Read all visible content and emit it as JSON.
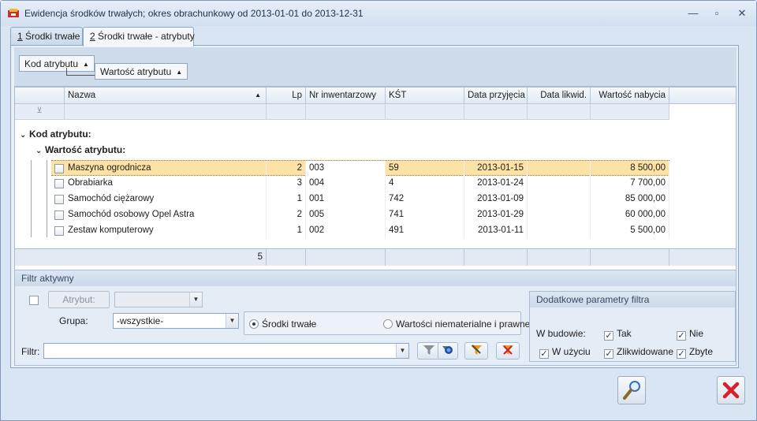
{
  "window": {
    "title": "Ewidencja środków trwałych; okres obrachunkowy od 2013-01-01 do 2013-12-31",
    "minimize": "—",
    "maximize": "▫",
    "close": "✕"
  },
  "tabs": [
    {
      "num": "1",
      "label": " Środki trwałe"
    },
    {
      "num": "2",
      "label": " Środki trwałe - atrybuty"
    }
  ],
  "grouping": {
    "chip1": "Kod atrybutu",
    "chip2": "Wartość atrybutu"
  },
  "grid": {
    "columns": [
      "Nazwa",
      "Lp",
      "Nr inwentarzowy",
      "KŚT",
      "Data przyjęcia",
      "Data likwid.",
      "Wartość nabycia"
    ],
    "group1_label": "Kod atrybutu:",
    "group2_label": "Wartość atrybutu:",
    "rows": [
      {
        "nazwa": "Maszyna ogrodnicza",
        "lp": "2",
        "nr": "003",
        "kst": "59",
        "data_przyjecia": "2013-01-15",
        "data_likwid": "",
        "wartosc": "8 500,00"
      },
      {
        "nazwa": "Obrabiarka",
        "lp": "3",
        "nr": "004",
        "kst": "4",
        "data_przyjecia": "2013-01-24",
        "data_likwid": "",
        "wartosc": "7 700,00"
      },
      {
        "nazwa": "Samochód ciężarowy",
        "lp": "1",
        "nr": "001",
        "kst": "742",
        "data_przyjecia": "2013-01-09",
        "data_likwid": "",
        "wartosc": "85 000,00"
      },
      {
        "nazwa": "Samochód osobowy Opel Astra",
        "lp": "2",
        "nr": "005",
        "kst": "741",
        "data_przyjecia": "2013-01-29",
        "data_likwid": "",
        "wartosc": "60 000,00"
      },
      {
        "nazwa": "Zestaw komputerowy",
        "lp": "1",
        "nr": "002",
        "kst": "491",
        "data_przyjecia": "2013-01-11",
        "data_likwid": "",
        "wartosc": "5 500,00"
      }
    ],
    "footer_count": "5"
  },
  "filter": {
    "title": "Filtr aktywny",
    "atrybut_button": "Atrybut:",
    "grupa_label": "Grupa:",
    "grupa_value": "-wszystkie-",
    "radio_srodki": "Środki trwałe",
    "radio_wartosci": "Wartości niematerialne i prawne",
    "filtr_label": "Filtr:",
    "filtr_value": ""
  },
  "extra": {
    "title": "Dodatkowe parametry filtra",
    "w_budowie": "W budowie:",
    "tak": "Tak",
    "nie": "Nie",
    "w_uzyciu": "W użyciu",
    "zlikwidowane": "Zlikwidowane",
    "zbyte": "Zbyte"
  }
}
